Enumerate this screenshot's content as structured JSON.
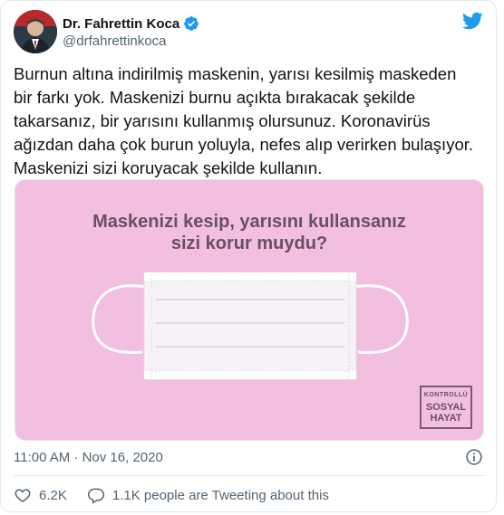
{
  "author": {
    "name": "Dr. Fahrettin Koca",
    "handle": "@drfahrettinkoca",
    "verified": true
  },
  "tweet": {
    "text": "Burnun altına indirilmiş maskenin, yarısı kesilmiş maskeden\nbir farkı yok. Maskenizi burnu açıkta bırakacak şekilde\ntakarsanız, bir yarısını kullanmış olursunuz. Koronavirüs\nağızdan daha çok burun yoluyla, nefes alıp verirken bulaşıyor.\nMaskenizi sizi koruyacak şekilde kullanın."
  },
  "media": {
    "title": "Maskenizi kesip, yarısını kullansanız\nsizi korur muydu?",
    "badge_line1": "KONTROLLÜ",
    "badge_line2": "SOSYAL",
    "badge_line3": "HAYAT",
    "background_color": "#f2bfe0"
  },
  "meta": {
    "timestamp": "11:00 AM · Nov 16, 2020"
  },
  "actions": {
    "likes": "6.2K",
    "replies_label": "1.1K people are Tweeting about this"
  },
  "colors": {
    "twitter_blue": "#1d9bf0",
    "text": "#0f1419",
    "secondary": "#536471"
  }
}
